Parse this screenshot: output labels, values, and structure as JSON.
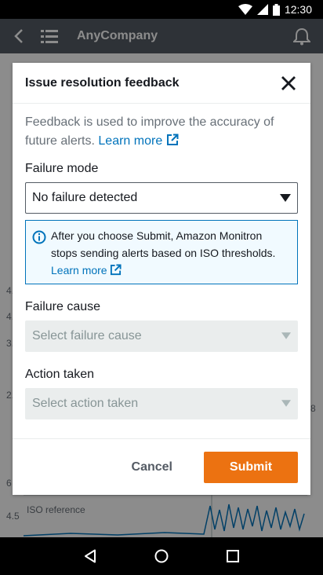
{
  "status_bar": {
    "time": "12:30"
  },
  "app_bar": {
    "title": "AnyCompany"
  },
  "background": {
    "axis_labels": [
      "4.",
      "4.",
      "3.",
      "2.",
      "6",
      "4.5"
    ],
    "chart_reference_label": "ISO reference",
    "right_tick": "8"
  },
  "modal": {
    "title": "Issue resolution feedback",
    "description": "Feedback is used to improve the accuracy of future alerts.",
    "learn_more_label": "Learn more",
    "failure_mode": {
      "label": "Failure mode",
      "value": "No failure detected"
    },
    "info_banner": {
      "text": "After you choose Submit, Amazon Monitron stops sending alerts based on ISO thresholds.",
      "link_label": "Learn more"
    },
    "failure_cause": {
      "label": "Failure cause",
      "placeholder": "Select failure cause"
    },
    "action_taken": {
      "label": "Action taken",
      "placeholder": "Select action taken"
    },
    "cancel_label": "Cancel",
    "submit_label": "Submit"
  },
  "colors": {
    "accent": "#ec7211",
    "link": "#0073bb",
    "info_bg": "#f1faff"
  }
}
